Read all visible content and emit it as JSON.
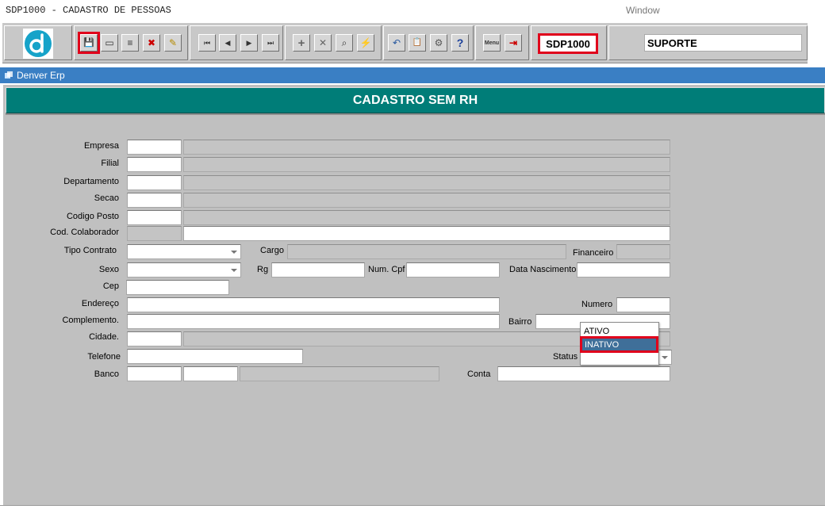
{
  "app": {
    "title": "SDP1000 - CADASTRO DE PESSOAS",
    "menu": "Window"
  },
  "toolbar": {
    "module_code": "SDP1000",
    "user": "SUPORTE",
    "buttons": [
      {
        "name": "save-icon",
        "glyph": "💾"
      },
      {
        "name": "window-icon",
        "glyph": "▭"
      },
      {
        "name": "print-icon",
        "glyph": "≡"
      },
      {
        "name": "clear-icon",
        "glyph": "✖"
      },
      {
        "name": "edit-icon",
        "glyph": "✎"
      },
      {
        "name": "first-record-icon",
        "glyph": "⏮"
      },
      {
        "name": "prev-record-icon",
        "glyph": "◀"
      },
      {
        "name": "next-record-icon",
        "glyph": "▶"
      },
      {
        "name": "last-record-icon",
        "glyph": "⏭"
      },
      {
        "name": "insert-record-icon",
        "glyph": "+"
      },
      {
        "name": "delete-record-icon",
        "glyph": "✕"
      },
      {
        "name": "query-icon",
        "glyph": "⌕"
      },
      {
        "name": "execute-query-icon",
        "glyph": "⚡"
      },
      {
        "name": "undo-icon",
        "glyph": "↶"
      },
      {
        "name": "clipboard-icon",
        "glyph": "📋"
      },
      {
        "name": "tools-icon",
        "glyph": "⚙"
      },
      {
        "name": "help-icon",
        "glyph": "?"
      },
      {
        "name": "menu-icon",
        "glyph": "Menu"
      },
      {
        "name": "exit-icon",
        "glyph": "⇥"
      }
    ]
  },
  "window": {
    "title": "Denver Erp"
  },
  "form": {
    "header": "CADASTRO SEM RH",
    "labels": {
      "empresa": "Empresa",
      "filial": "Filial",
      "departamento": "Departamento",
      "secao": "Secao",
      "codigo_posto": "Codigo Posto",
      "cod_colaborador": "Cod. Colaborador",
      "tipo_contrato": "Tipo Contrato",
      "cargo": "Cargo",
      "financeiro": "Financeiro",
      "sexo": "Sexo",
      "rg": "Rg",
      "num_cpf": "Num. Cpf",
      "data_nascimento": "Data Nascimento",
      "cep": "Cep",
      "endereco": "Endereço",
      "numero": "Numero",
      "complemento": "Complemento.",
      "bairro": "Bairro",
      "cidade": "Cidade.",
      "telefone": "Telefone",
      "status": "Status",
      "banco": "Banco",
      "conta": "Conta"
    },
    "status_options": [
      "ATIVO",
      "INATIVO"
    ],
    "status_highlighted": "INATIVO"
  },
  "colors": {
    "header_band": "#007d78",
    "window_bar": "#3a7fc4",
    "highlight": "#e0001b",
    "selected_option": "#3f6f99"
  }
}
